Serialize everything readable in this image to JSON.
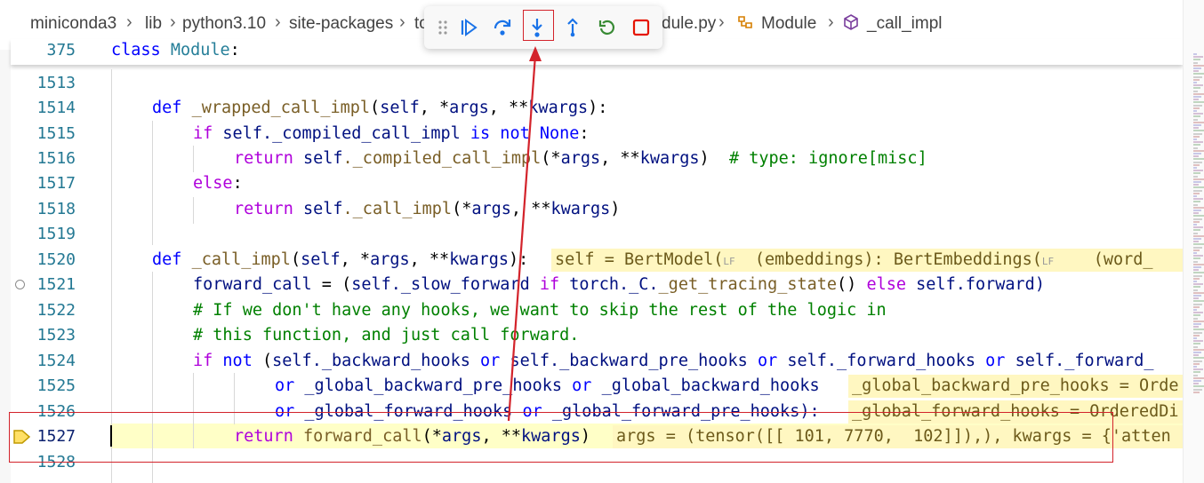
{
  "breadcrumb": {
    "items": [
      "miniconda3",
      "lib",
      "python3.10",
      "site-packages",
      "to",
      "dule.py",
      "Module",
      "_call_impl"
    ]
  },
  "debug_toolbar": {
    "buttons": [
      "drag-handle",
      "continue",
      "step-over",
      "step-into",
      "step-out",
      "restart",
      "stop"
    ],
    "highlighted": "step-into",
    "colors": {
      "continue": "#1a73e8",
      "step_over": "#1a73e8",
      "step_into": "#1a73e8",
      "step_out": "#1a73e8",
      "restart": "#388a34",
      "stop": "#e51400"
    }
  },
  "sticky_header": {
    "line_number": "375",
    "kw": "class",
    "name": "Module",
    "colon": ":"
  },
  "lines": [
    {
      "num": "1513"
    },
    {
      "num": "1514",
      "t": [
        "def",
        " ",
        "_wrapped_call_impl",
        "(",
        "self",
        ", *",
        "args",
        ", **",
        "kwargs",
        "):"
      ]
    },
    {
      "num": "1515",
      "t": [
        "if",
        " ",
        "self",
        "._compiled_call_impl ",
        "is not",
        " ",
        "None",
        ":"
      ]
    },
    {
      "num": "1516",
      "t": [
        "return",
        " ",
        "self",
        "._compiled_call_impl",
        "(*",
        "args",
        ", **",
        "kwargs",
        ")  ",
        "# type: ignore[misc]"
      ]
    },
    {
      "num": "1517",
      "t": [
        "else",
        ":"
      ]
    },
    {
      "num": "1518",
      "t": [
        "return",
        " ",
        "self",
        "._call_impl",
        "(*",
        "args",
        ", **",
        "kwargs",
        ")"
      ]
    },
    {
      "num": "1519"
    },
    {
      "num": "1520",
      "t": [
        "def",
        " ",
        "_call_impl",
        "(",
        "self",
        ", *",
        "args",
        ", **",
        "kwargs",
        "):"
      ],
      "inline": "self = BertModel(",
      "inline_lf": "LF",
      "inline2": "  (embeddings): BertEmbeddings(",
      "inline2_lf": "LF",
      "inline3": "    (word_"
    },
    {
      "num": "1521",
      "t": [
        "forward_call",
        " = (",
        "self",
        "._slow_forward ",
        "if",
        " ",
        "torch",
        "._C.",
        "_get_tracing_state",
        "() ",
        "else",
        " ",
        "self",
        ".forward)"
      ]
    },
    {
      "num": "1522",
      "t": [
        "# If we don't have any hooks, we want to skip the rest of the logic in"
      ]
    },
    {
      "num": "1523",
      "t": [
        "# this function, and just call forward."
      ]
    },
    {
      "num": "1524",
      "t": [
        "if",
        " ",
        "not",
        " (",
        "self",
        "._backward_hooks ",
        "or",
        " ",
        "self",
        "._backward_pre_hooks ",
        "or",
        " ",
        "self",
        "._forward_hooks ",
        "or",
        " ",
        "self",
        "._forward_"
      ]
    },
    {
      "num": "1525",
      "t": [
        "or",
        " _global_backward_pre_hooks ",
        "or",
        " _global_backward_hooks"
      ],
      "inline": "_global_backward_pre_hooks = Orde"
    },
    {
      "num": "1526",
      "t": [
        "or",
        " _global_forward_hooks ",
        "or",
        " _global_forward_pre_hooks):"
      ],
      "inline": "_global_forward_hooks = OrderedDi"
    },
    {
      "num": "1527",
      "t": [
        "return",
        " ",
        "forward_call",
        "(*",
        "args",
        ", **",
        "kwargs",
        ")"
      ],
      "inline": "args = (tensor([[ 101, 7770,  102]]),), kwargs = {'atten"
    },
    {
      "num": "1528"
    }
  ]
}
